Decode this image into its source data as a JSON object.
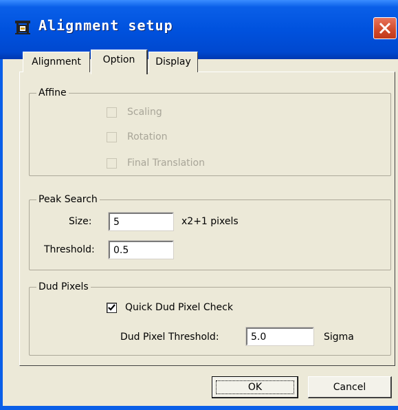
{
  "window": {
    "title": "Alignment setup"
  },
  "tabs": [
    {
      "label": "Alignment",
      "active": false
    },
    {
      "label": "Option",
      "active": true
    },
    {
      "label": "Display",
      "active": false
    }
  ],
  "affine": {
    "title": "Affine",
    "scaling": {
      "label": "Scaling",
      "checked": false,
      "enabled": false
    },
    "rotation": {
      "label": "Rotation",
      "checked": false,
      "enabled": false
    },
    "final_translation": {
      "label": "Final Translation",
      "checked": false,
      "enabled": false
    }
  },
  "peak_search": {
    "title": "Peak Search",
    "size_label": "Size:",
    "size_value": "5",
    "size_unit": "x2+1 pixels",
    "threshold_label": "Threshold:",
    "threshold_value": "0.5"
  },
  "dud_pixels": {
    "title": "Dud Pixels",
    "quick_check": {
      "label": "Quick Dud Pixel Check",
      "checked": true
    },
    "threshold_label": "Dud Pixel Threshold:",
    "threshold_value": "5.0",
    "threshold_unit": "Sigma"
  },
  "buttons": {
    "ok": "OK",
    "cancel": "Cancel"
  },
  "colors": {
    "titlebar": "#0052de",
    "close": "#d04a2a",
    "dialog_bg": "#ece9d8"
  }
}
